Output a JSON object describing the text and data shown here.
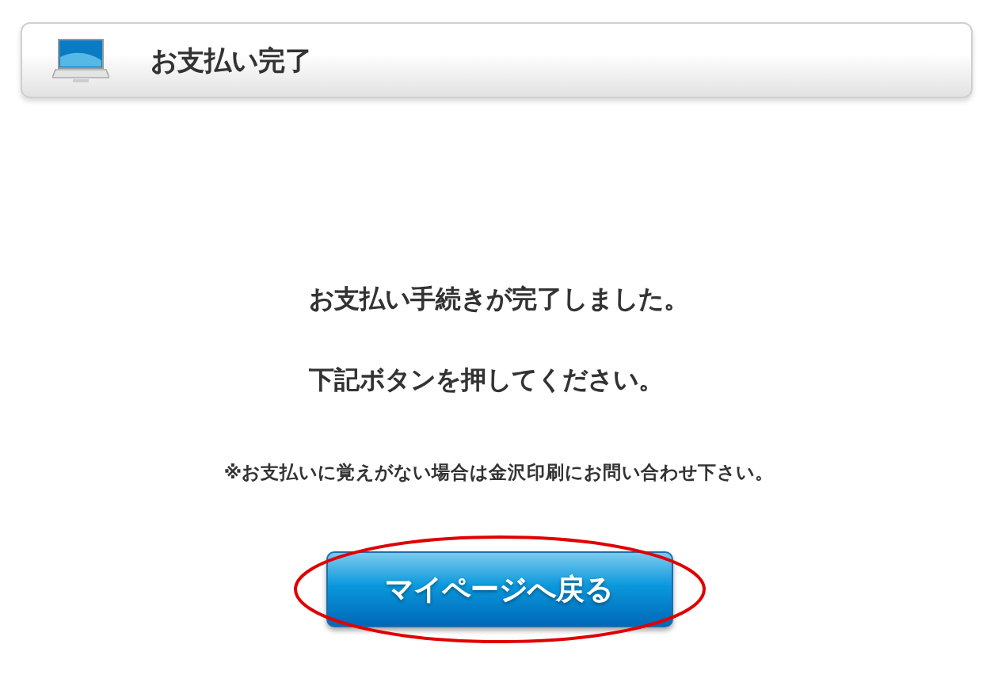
{
  "header": {
    "title": "お支払い完了"
  },
  "messages": [
    "お支払い手続きが完了しました。",
    "下記ボタンを押してください。"
  ],
  "note": "※お支払いに覚えがない場合は金沢印刷にお問い合わせ下さい。",
  "button": {
    "label": "マイページへ戻る",
    "highlighted": true
  }
}
